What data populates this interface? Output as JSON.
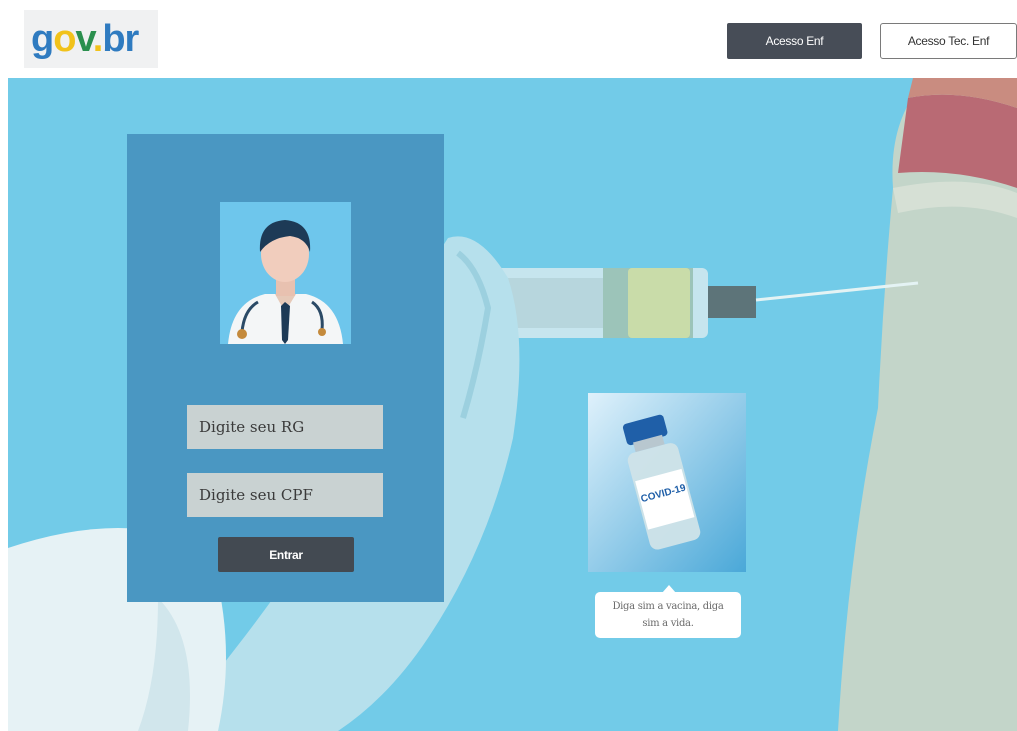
{
  "header": {
    "logo_text": "gov.br",
    "buttons": {
      "enf": "Acesso Enf",
      "tec_enf": "Acesso Tec. Enf"
    }
  },
  "login": {
    "rg_placeholder": "Digite seu RG",
    "cpf_placeholder": "Digite seu CPF",
    "submit_label": "Entrar"
  },
  "promo": {
    "vial_label": "COVID-19",
    "caption": "Diga sim a vacina, diga sim a vida."
  },
  "colors": {
    "hero_background": "#72cbe8",
    "login_panel": "#4a97c2",
    "dark_button": "#474d57",
    "input_background": "#c9d2d2"
  }
}
